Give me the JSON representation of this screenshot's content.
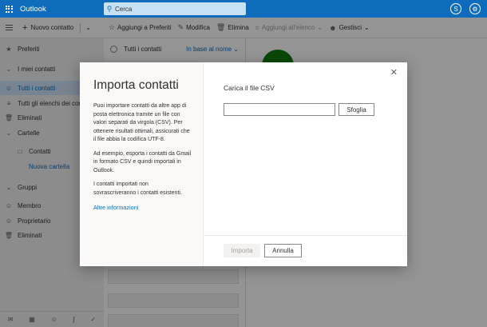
{
  "app": {
    "title": "Outlook"
  },
  "search": {
    "placeholder": "Cerca"
  },
  "command_bar": {
    "new_contact": "Nuovo contatto",
    "add_favorites": "Aggiungi a Preferiti",
    "edit": "Modifica",
    "delete": "Elimina",
    "add_to_list": "Aggiungi all'elenco",
    "manage": "Gestisci"
  },
  "sidebar": {
    "favorites": "Preferiti",
    "my_contacts": "I miei contatti",
    "all_contacts": "Tutti i contatti",
    "all_lists": "Tutti gli elenchi dei contatti",
    "deleted": "Eliminati",
    "folders": "Cartelle",
    "contacts": "Contatti",
    "new_folder": "Nuova cartella",
    "groups": "Gruppi",
    "member": "Membro",
    "owner": "Proprietario",
    "groups_deleted": "Eliminati"
  },
  "list": {
    "header": "Tutti i contatti",
    "sort": "In base al nome"
  },
  "modal": {
    "title": "Importa contatti",
    "para1": "Puoi importare contatti da altre app di posta elettronica tramite un file con valori separati da virgola (CSV). Per ottenere risultati ottimali, assicurati che il file abbia la codifica UTF-8.",
    "para2": "Ad esempio, esporta i contatti da Gmail in formato CSV e quindi importali in Outlook.",
    "para3": "I contatti importati non sovrascriveranno i contatti esistenti.",
    "more_info": "Altre informazioni",
    "csv_label": "Carica il file CSV",
    "file_value": "",
    "browse": "Sfoglia",
    "import": "Importa",
    "cancel": "Annulla"
  },
  "colors": {
    "brand": "#0f6cbd",
    "avatar": "#107c10"
  }
}
